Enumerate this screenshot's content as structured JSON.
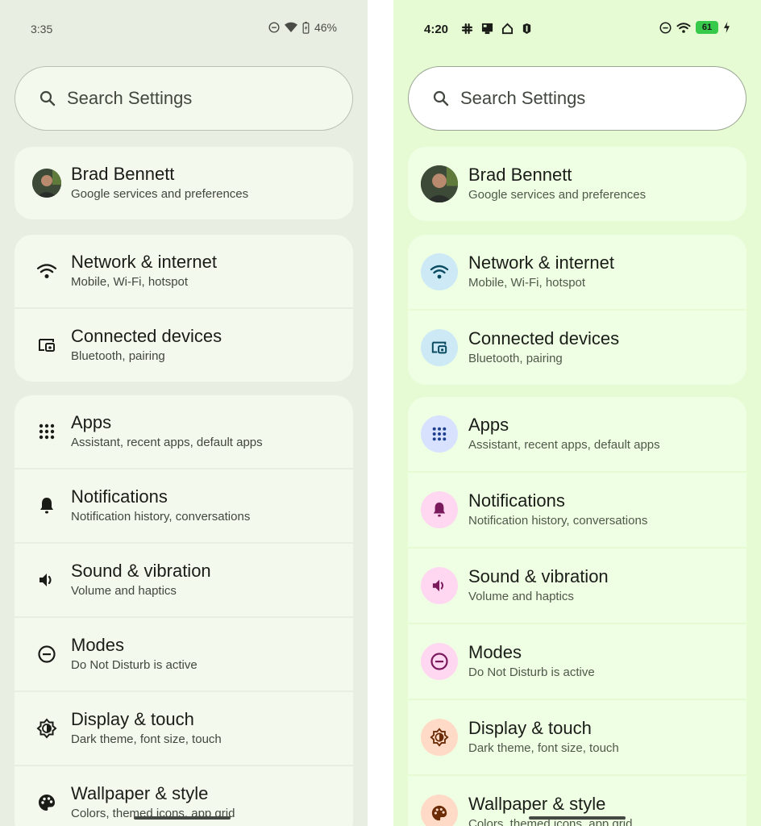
{
  "left": {
    "status": {
      "time": "3:35",
      "battery": "46%"
    },
    "search": {
      "placeholder": "Search Settings"
    },
    "account": {
      "name": "Brad Bennett",
      "subtitle": "Google services and preferences"
    },
    "items": [
      {
        "title": "Network & internet",
        "subtitle": "Mobile, Wi-Fi, hotspot",
        "icon": "wifi-icon"
      },
      {
        "title": "Connected devices",
        "subtitle": "Bluetooth, pairing",
        "icon": "devices-icon"
      },
      {
        "title": "Apps",
        "subtitle": "Assistant, recent apps, default apps",
        "icon": "apps-grid-icon"
      },
      {
        "title": "Notifications",
        "subtitle": "Notification history, conversations",
        "icon": "bell-icon"
      },
      {
        "title": "Sound & vibration",
        "subtitle": "Volume and haptics",
        "icon": "speaker-icon"
      },
      {
        "title": "Modes",
        "subtitle": "Do Not Disturb is active",
        "icon": "dnd-icon"
      },
      {
        "title": "Display & touch",
        "subtitle": "Dark theme, font size, touch",
        "icon": "brightness-icon"
      },
      {
        "title": "Wallpaper & style",
        "subtitle": "Colors, themed icons, app grid",
        "icon": "palette-icon"
      }
    ]
  },
  "right": {
    "status": {
      "time": "4:20",
      "battery": "61"
    },
    "search": {
      "placeholder": "Search Settings"
    },
    "account": {
      "name": "Brad Bennett",
      "subtitle": "Google services and preferences"
    },
    "items": [
      {
        "title": "Network & internet",
        "subtitle": "Mobile, Wi-Fi, hotspot",
        "icon": "wifi-icon",
        "bg": "#cde9f6",
        "fg": "#0b4b61"
      },
      {
        "title": "Connected devices",
        "subtitle": "Bluetooth, pairing",
        "icon": "devices-icon",
        "bg": "#cde9f6",
        "fg": "#0b4b61"
      },
      {
        "title": "Apps",
        "subtitle": "Assistant, recent apps, default apps",
        "icon": "apps-grid-icon",
        "bg": "#d8e2ff",
        "fg": "#1f3f8f"
      },
      {
        "title": "Notifications",
        "subtitle": "Notification history, conversations",
        "icon": "bell-icon",
        "bg": "#ffd7f1",
        "fg": "#7a1a5c"
      },
      {
        "title": "Sound & vibration",
        "subtitle": "Volume and haptics",
        "icon": "speaker-icon",
        "bg": "#ffd7f1",
        "fg": "#7a1a5c"
      },
      {
        "title": "Modes",
        "subtitle": "Do Not Disturb is active",
        "icon": "dnd-icon",
        "bg": "#ffd7f1",
        "fg": "#7a1a5c"
      },
      {
        "title": "Display & touch",
        "subtitle": "Dark theme, font size, touch",
        "icon": "brightness-icon",
        "bg": "#ffdbc7",
        "fg": "#6b2b06"
      },
      {
        "title": "Wallpaper & style",
        "subtitle": "Colors, themed icons, app grid",
        "icon": "palette-icon",
        "bg": "#ffdbc7",
        "fg": "#6b2b06"
      }
    ]
  }
}
